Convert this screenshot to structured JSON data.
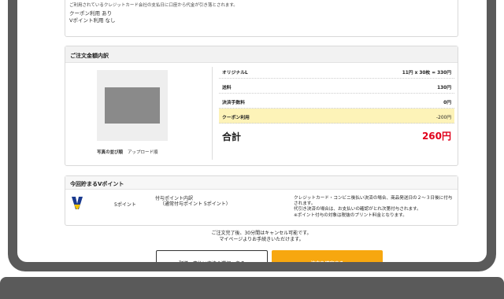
{
  "payment": {
    "note": "ご利用されているクレジットカード会社の支払日に口座から代金が引き落とされます。",
    "coupon_usage": "クーポン利用 あり",
    "vpoint_usage": "Vポイント利用 なし"
  },
  "summary": {
    "heading": "ご注文金額内訳",
    "photo_sort_label": "写真の並び順",
    "photo_sort_value": "アップロード順",
    "rows": [
      {
        "label": "オリジナルL",
        "value": "11円 x 30枚 = 330円"
      },
      {
        "label": "送料",
        "value": "130円"
      },
      {
        "label": "決済手数料",
        "value": "0円"
      },
      {
        "label": "クーポン利用",
        "value": "-200円"
      }
    ],
    "total_label": "合計",
    "total_value": "260円"
  },
  "vpoint": {
    "heading": "今回貯まるVポイント",
    "points": "5ポイント",
    "detail_title": "付与ポイント内訳",
    "detail_sub": "（通常付与ポイント 5ポイント）",
    "note": [
      "クレジットカード・コンビニ後払い決済の場合、商品発送日の２〜３日後に付与されます。",
      "代引き決済の場合は、お支払いの確認がとれ次第付与されます。",
      "※ポイント付与の対象は税抜のプリント料金となります。"
    ]
  },
  "notice": [
    "ご注文完了後、30分間はキャンセル可能です。",
    "マイページよりお手続きいただけます。"
  ],
  "buttons": {
    "back": "配送・支払い方法の選択へ戻る",
    "confirm": "注文を確定する"
  },
  "colors": {
    "accent": "#f7a70f",
    "total": "#e0001b",
    "coupon_highlight": "#fdf3b8",
    "vpoint_blue": "#1a3a8f",
    "vpoint_yellow": "#f5c400"
  }
}
